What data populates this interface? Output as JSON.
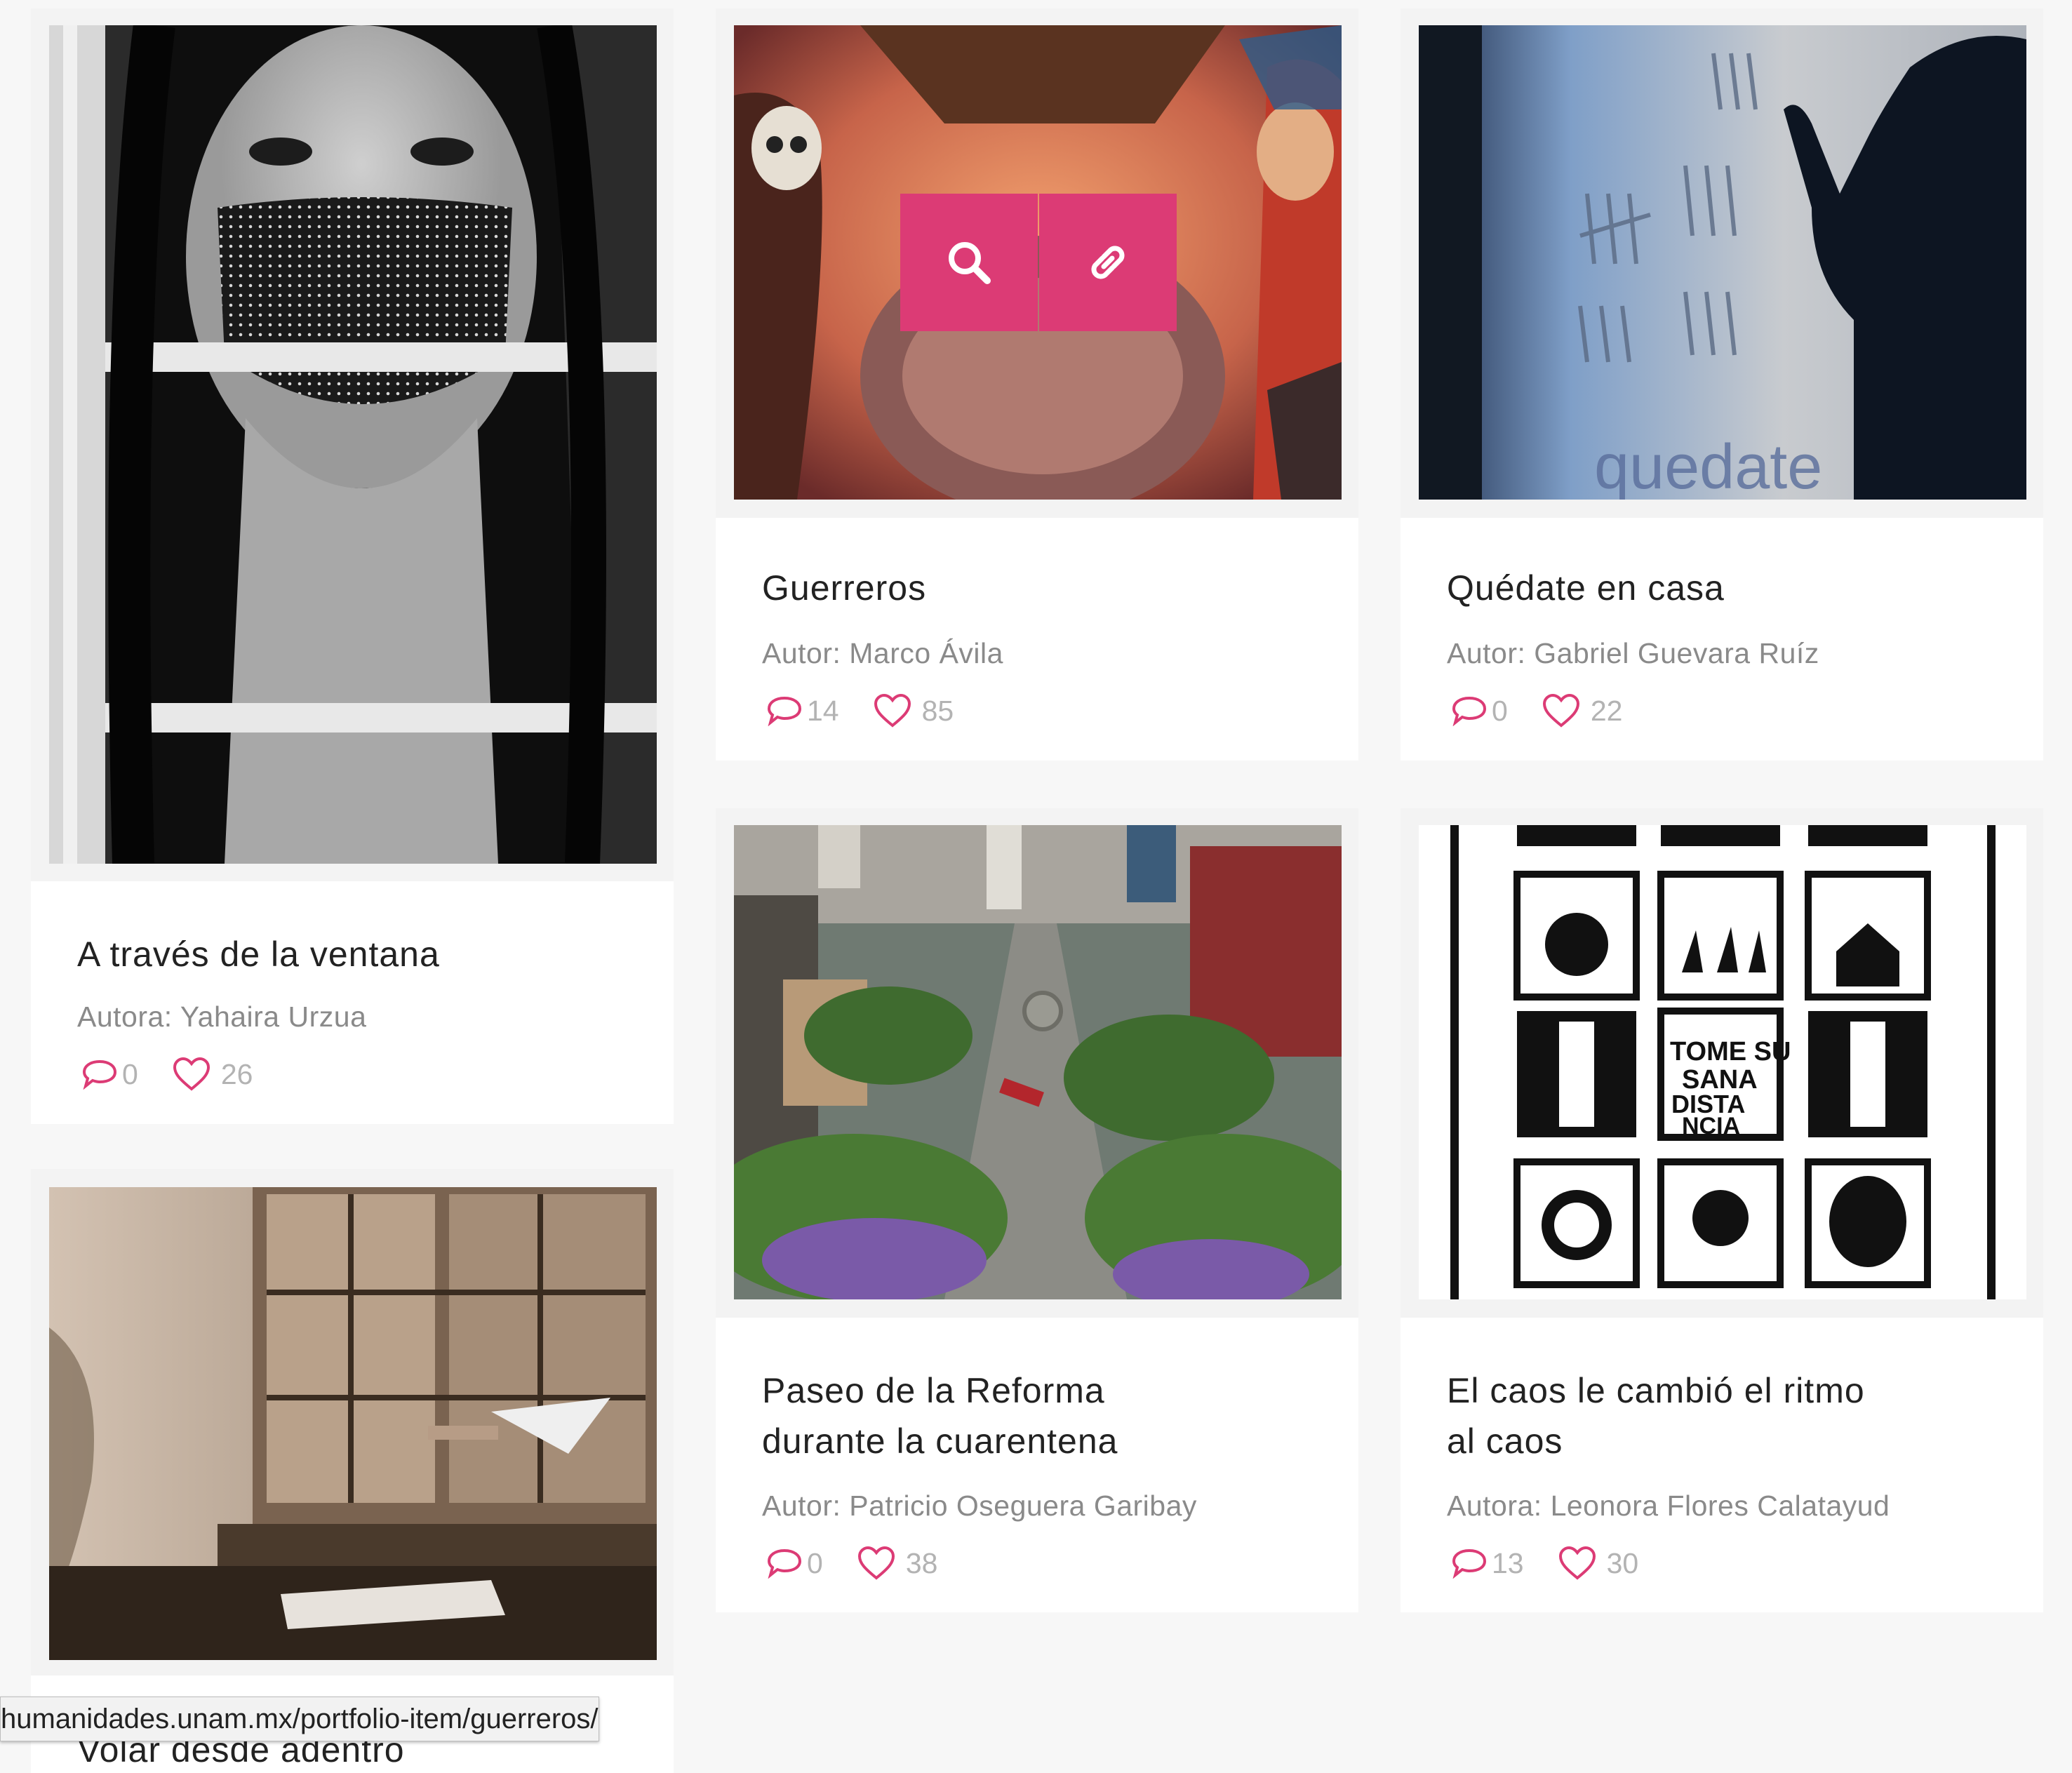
{
  "accent_color": "#dc3b75",
  "items": [
    {
      "title": "A través de la ventana",
      "author": "Autora: Yahaira Urzua",
      "comments": "0",
      "likes": "26"
    },
    {
      "title": "Guerreros",
      "author": "Autor: Marco Ávila",
      "comments": "14",
      "likes": "85"
    },
    {
      "title": "Quédate en casa",
      "author": "Autor: Gabriel Guevara Ruíz",
      "comments": "0",
      "likes": "22"
    },
    {
      "title_line1": "Paseo de la Reforma",
      "title_line2": "durante la cuarentena",
      "author": "Autor: Patricio Oseguera Garibay",
      "comments": "0",
      "likes": "38"
    },
    {
      "title_line1": "El caos le cambió el ritmo",
      "title_line2": "al caos",
      "author": "Autora: Leonora Flores Calatayud",
      "comments": "13",
      "likes": "30"
    },
    {
      "title": "Volar desde adentro"
    }
  ],
  "overlay": {
    "zoom_icon": "search-icon",
    "link_icon": "link-icon"
  },
  "status_url": "humanidades.unam.mx/portfolio-item/guerreros/"
}
